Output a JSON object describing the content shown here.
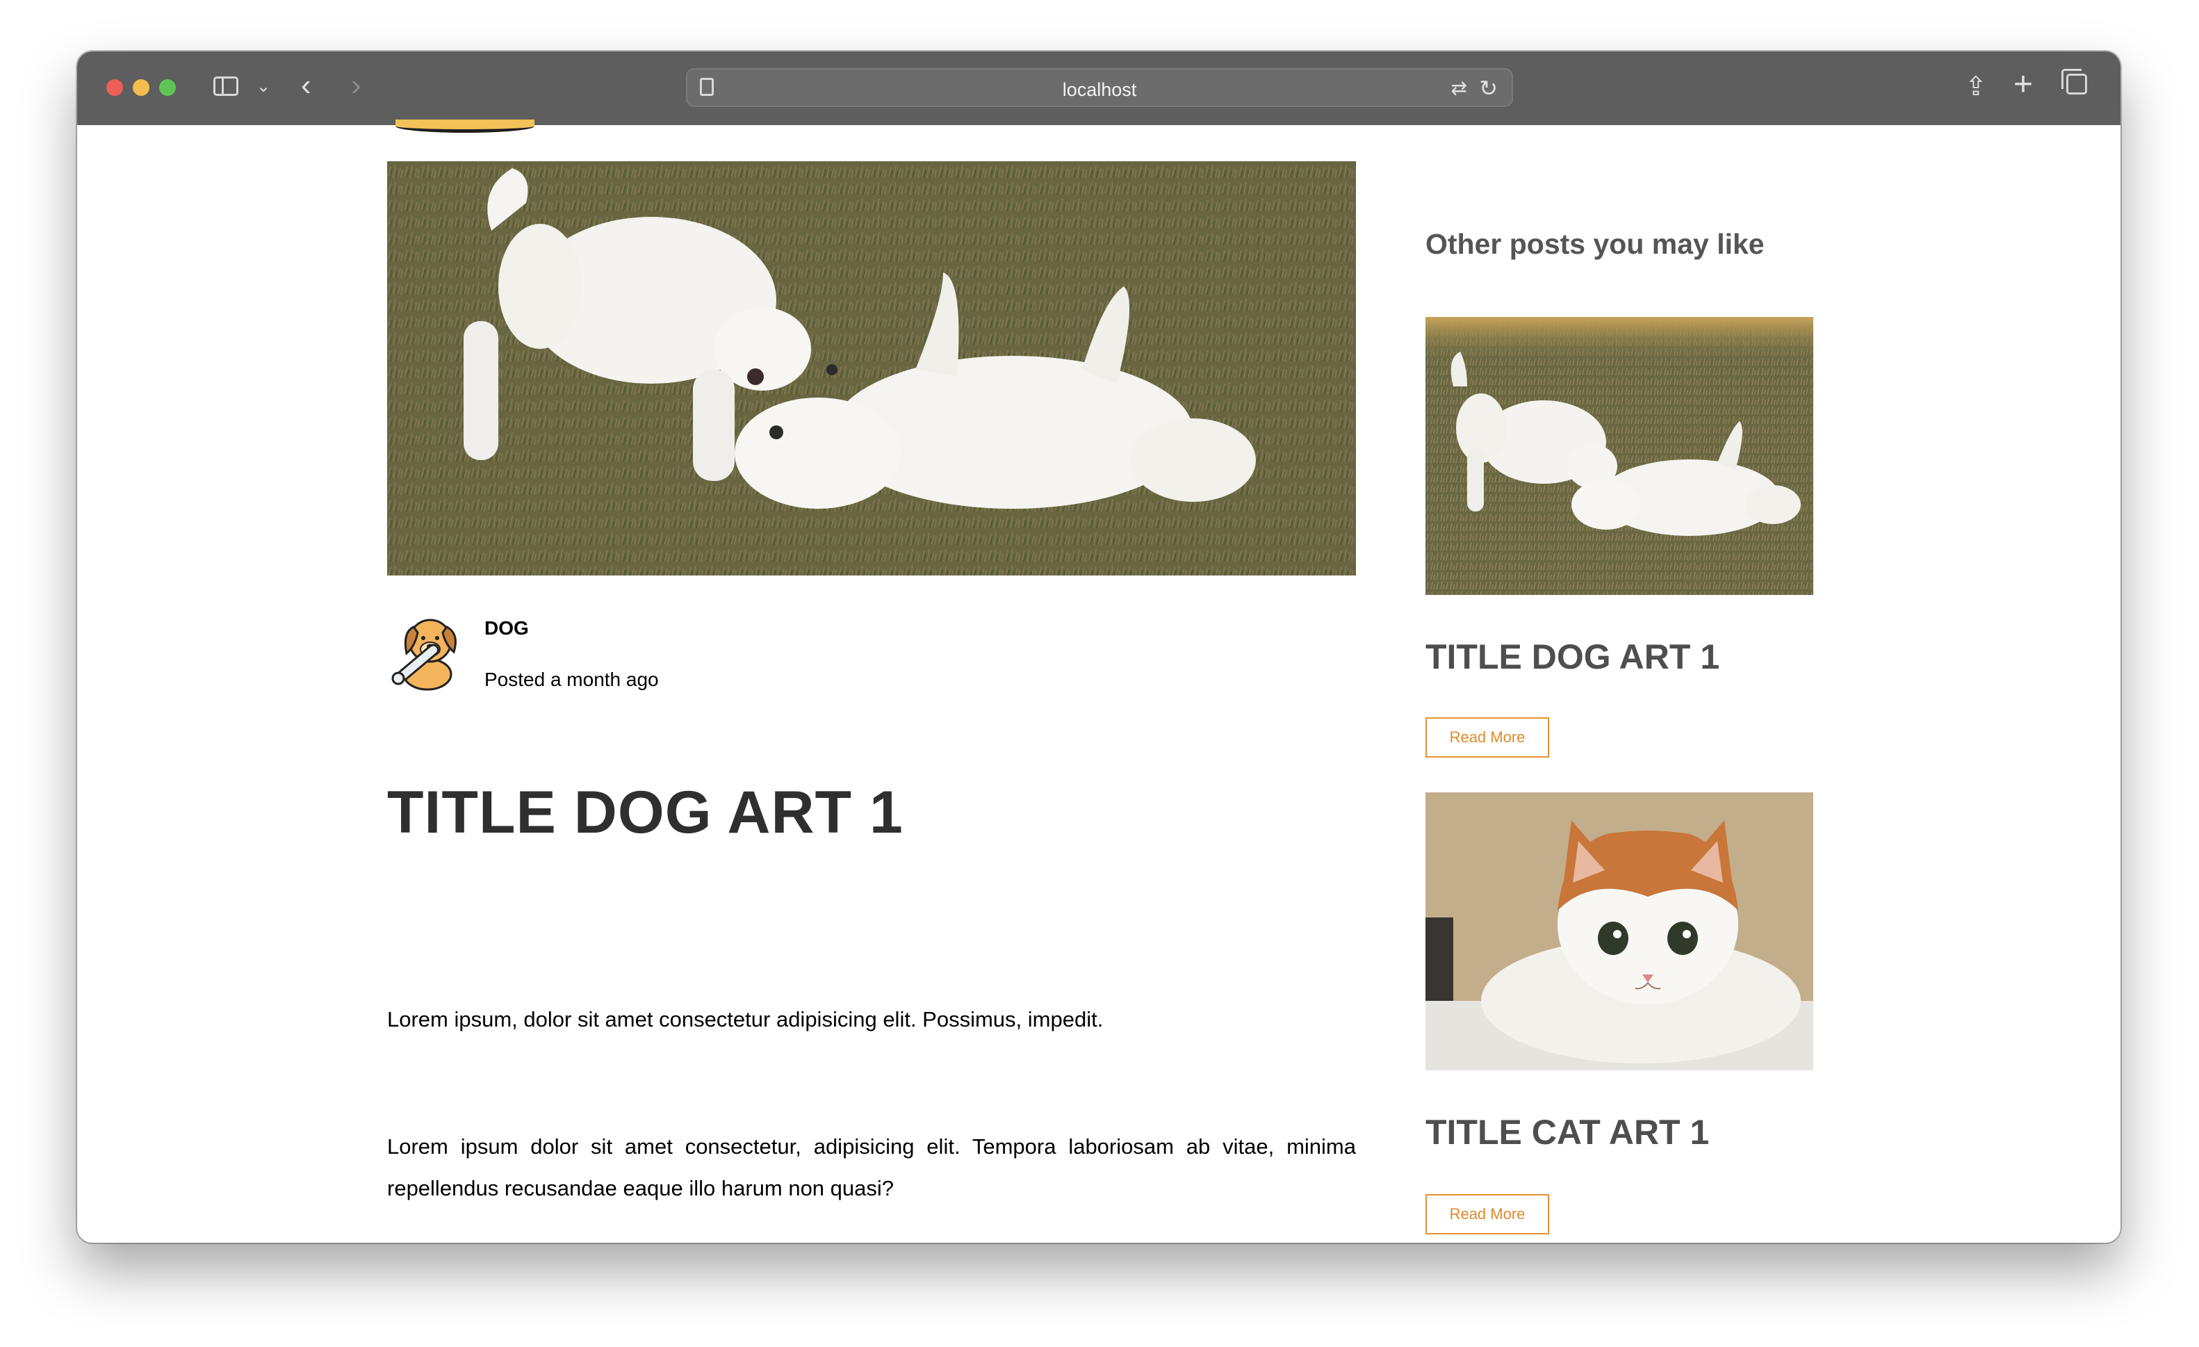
{
  "browser": {
    "url": "localhost"
  },
  "post": {
    "author": "DOG",
    "posted": "Posted a month ago",
    "title": "TITLE DOG ART 1",
    "paragraphs": [
      "Lorem ipsum, dolor sit amet consectetur adipisicing elit. Possimus, impedit.",
      "Lorem ipsum dolor sit amet consectetur, adipisicing elit. Tempora laboriosam ab vitae, minima repellendus recusandae eaque illo harum non quasi?"
    ]
  },
  "sidebar": {
    "heading": "Other posts you may like",
    "cards": [
      {
        "title": "TITLE DOG ART 1",
        "button": "Read More"
      },
      {
        "title": "TITLE CAT ART 1",
        "button": "Read More"
      }
    ]
  },
  "colors": {
    "accent": "#e8922e",
    "title_text": "#2f2f2f",
    "titlebar": "#5e5e5e"
  },
  "icons": [
    "sidebar-icon",
    "chevron-down-icon",
    "back-icon",
    "forward-icon",
    "reader-icon",
    "translate-icon",
    "reload-icon",
    "share-icon",
    "new-tab-icon",
    "tabs-overview-icon"
  ]
}
